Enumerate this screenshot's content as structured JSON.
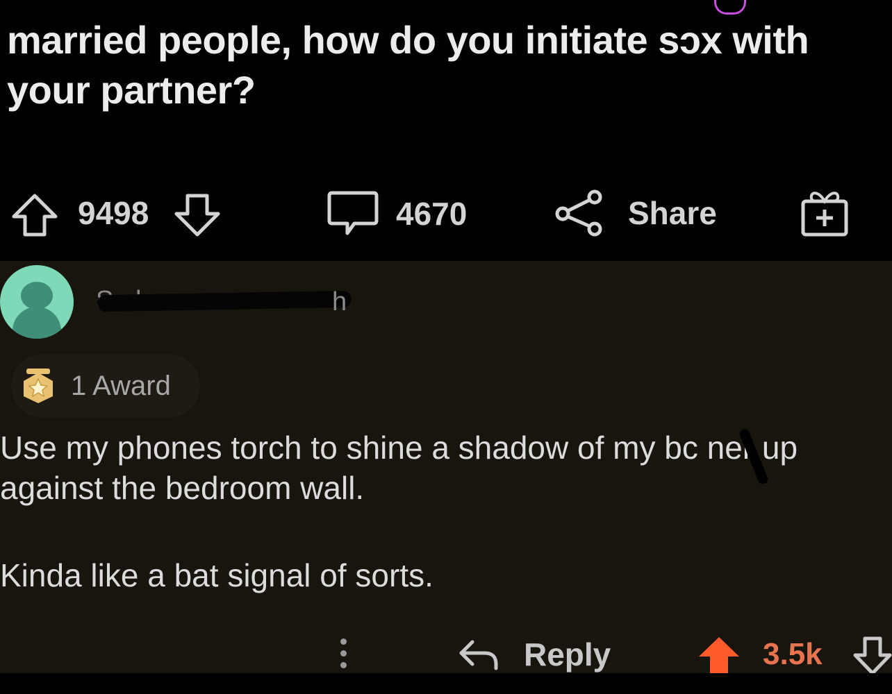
{
  "post": {
    "title": "married people, how do you initiate sɔx with your partner?",
    "upvotes": "9498",
    "comments": "4670",
    "share_label": "Share",
    "icons": {
      "upvote": "upvote-arrow-icon",
      "downvote": "downvote-arrow-icon",
      "comment": "comment-bubble-icon",
      "share": "share-icon",
      "gift": "gift-award-icon"
    }
  },
  "comment": {
    "username": "S...hooner...",
    "age": "h",
    "award_label": "1 Award",
    "paragraphs": [
      "Use my phones torch to shine a shadow of my bc ner up against the bedroom wall.",
      "Kinda like a bat signal of sorts."
    ],
    "reply_label": "Reply",
    "score": "3.5k",
    "colors": {
      "background": "#17150e",
      "score": "#e8734f",
      "upvote_active": "#ff5a2b",
      "avatar": "#7fd9b9",
      "award_medal": "#e8c271"
    },
    "icons": {
      "avatar": "snoo-avatar-icon",
      "award": "award-medal-icon",
      "more": "more-options-icon",
      "reply": "reply-arrow-icon",
      "upvote": "upvote-arrow-icon",
      "downvote": "downvote-arrow-icon"
    }
  }
}
